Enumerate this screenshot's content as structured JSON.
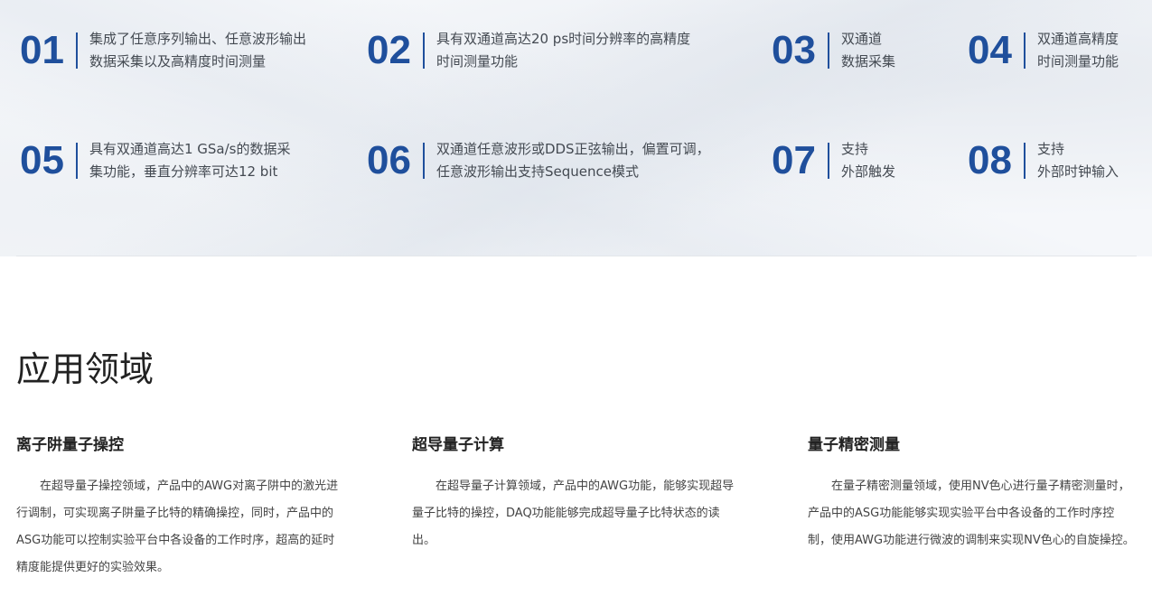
{
  "features": [
    {
      "num": "01",
      "lines": [
        "集成了任意序列输出、任意波形输出",
        "数据采集以及高精度时间测量"
      ]
    },
    {
      "num": "02",
      "lines": [
        "具有双通道高达20 ps时间分辨率的高精度",
        "时间测量功能"
      ]
    },
    {
      "num": "03",
      "lines": [
        "双通道",
        "数据采集"
      ]
    },
    {
      "num": "04",
      "lines": [
        "双通道高精度",
        "时间测量功能"
      ]
    },
    {
      "num": "05",
      "lines": [
        "具有双通道高达1 GSa/s的数据采",
        "集功能，垂直分辨率可达12 bit"
      ]
    },
    {
      "num": "06",
      "lines": [
        "双通道任意波形或DDS正弦输出，偏置可调，",
        "任意波形输出支持Sequence模式"
      ]
    },
    {
      "num": "07",
      "lines": [
        "支持",
        "外部触发"
      ]
    },
    {
      "num": "08",
      "lines": [
        "支持",
        "外部时钟输入"
      ]
    }
  ],
  "applications": {
    "title": "应用领域",
    "items": [
      {
        "heading": "离子阱量子操控",
        "body": "在超导量子操控领域，产品中的AWG对离子阱中的激光进行调制，可实现离子阱量子比特的精确操控，同时，产品中的ASG功能可以控制实验平台中各设备的工作时序，超高的延时精度能提供更好的实验效果。"
      },
      {
        "heading": "超导量子计算",
        "body": "在超导量子计算领域，产品中的AWG功能，能够实现超导量子比特的操控，DAQ功能能够完成超导量子比特状态的读出。"
      },
      {
        "heading": "量子精密测量",
        "body": "在量子精密测量领域，使用NV色心进行量子精密测量时，产品中的ASG功能能够实现实验平台中各设备的工作时序控制，使用AWG功能进行微波的调制来实现NV色心的自旋操控。"
      }
    ]
  },
  "colors": {
    "accent": "#1f4f9c",
    "text": "#444a52",
    "heading": "#222222"
  }
}
